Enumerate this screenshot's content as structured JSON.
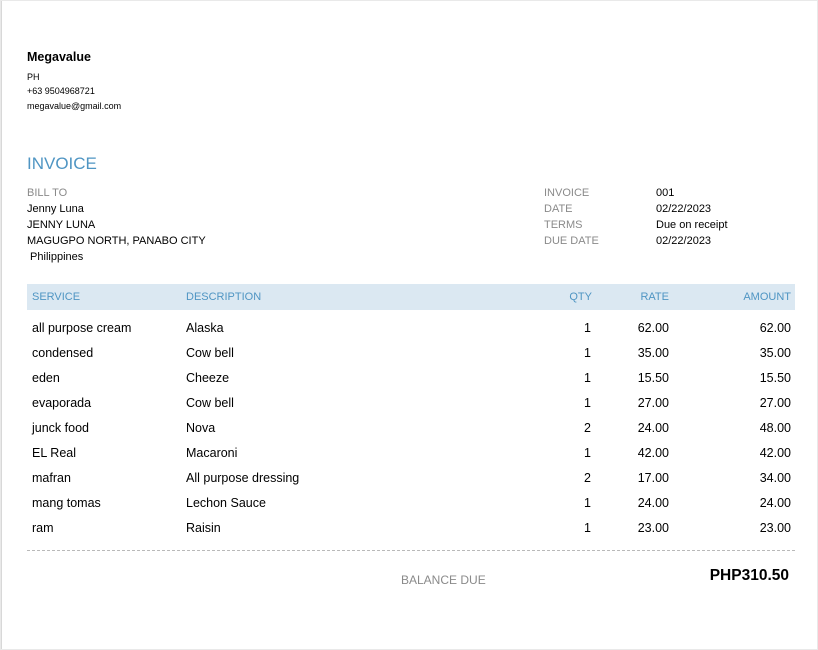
{
  "company": {
    "name": "Megavalue",
    "country": "PH",
    "phone": "+63 9504968721",
    "email": "megavalue@gmail.com"
  },
  "invoice": {
    "title": "INVOICE",
    "bill_to_label": "BILL TO",
    "bill_to_lines": [
      "Jenny Luna",
      "JENNY LUNA",
      "MAGUGPO NORTH, PANABO CITY",
      " Philippines"
    ],
    "meta": [
      {
        "label": "INVOICE",
        "value": "001"
      },
      {
        "label": "DATE",
        "value": "02/22/2023"
      },
      {
        "label": "TERMS",
        "value": "Due on receipt"
      },
      {
        "label": "DUE DATE",
        "value": "02/22/2023"
      }
    ]
  },
  "table": {
    "headers": {
      "service": "SERVICE",
      "description": "DESCRIPTION",
      "qty": "QTY",
      "rate": "RATE",
      "amount": "AMOUNT"
    },
    "rows": [
      {
        "service": "all purpose cream",
        "description": "Alaska",
        "qty": "1",
        "rate": "62.00",
        "amount": "62.00"
      },
      {
        "service": "condensed",
        "description": "Cow bell",
        "qty": "1",
        "rate": "35.00",
        "amount": "35.00"
      },
      {
        "service": "eden",
        "description": "Cheeze",
        "qty": "1",
        "rate": "15.50",
        "amount": "15.50"
      },
      {
        "service": "evaporada",
        "description": "Cow bell",
        "qty": "1",
        "rate": "27.00",
        "amount": "27.00"
      },
      {
        "service": "junck food",
        "description": "Nova",
        "qty": "2",
        "rate": "24.00",
        "amount": "48.00"
      },
      {
        "service": "EL Real",
        "description": "Macaroni",
        "qty": "1",
        "rate": "42.00",
        "amount": "42.00"
      },
      {
        "service": "mafran",
        "description": "All purpose dressing",
        "qty": "2",
        "rate": "17.00",
        "amount": "34.00"
      },
      {
        "service": "mang tomas",
        "description": "Lechon Sauce",
        "qty": "1",
        "rate": "24.00",
        "amount": "24.00"
      },
      {
        "service": "ram",
        "description": "Raisin",
        "qty": "1",
        "rate": "23.00",
        "amount": "23.00"
      }
    ]
  },
  "summary": {
    "balance_label": "BALANCE DUE",
    "balance_amount": "PHP310.50"
  },
  "colors": {
    "accent": "#4f95c3",
    "header_bg": "#dbe8f2",
    "muted": "#8a8a8a"
  }
}
